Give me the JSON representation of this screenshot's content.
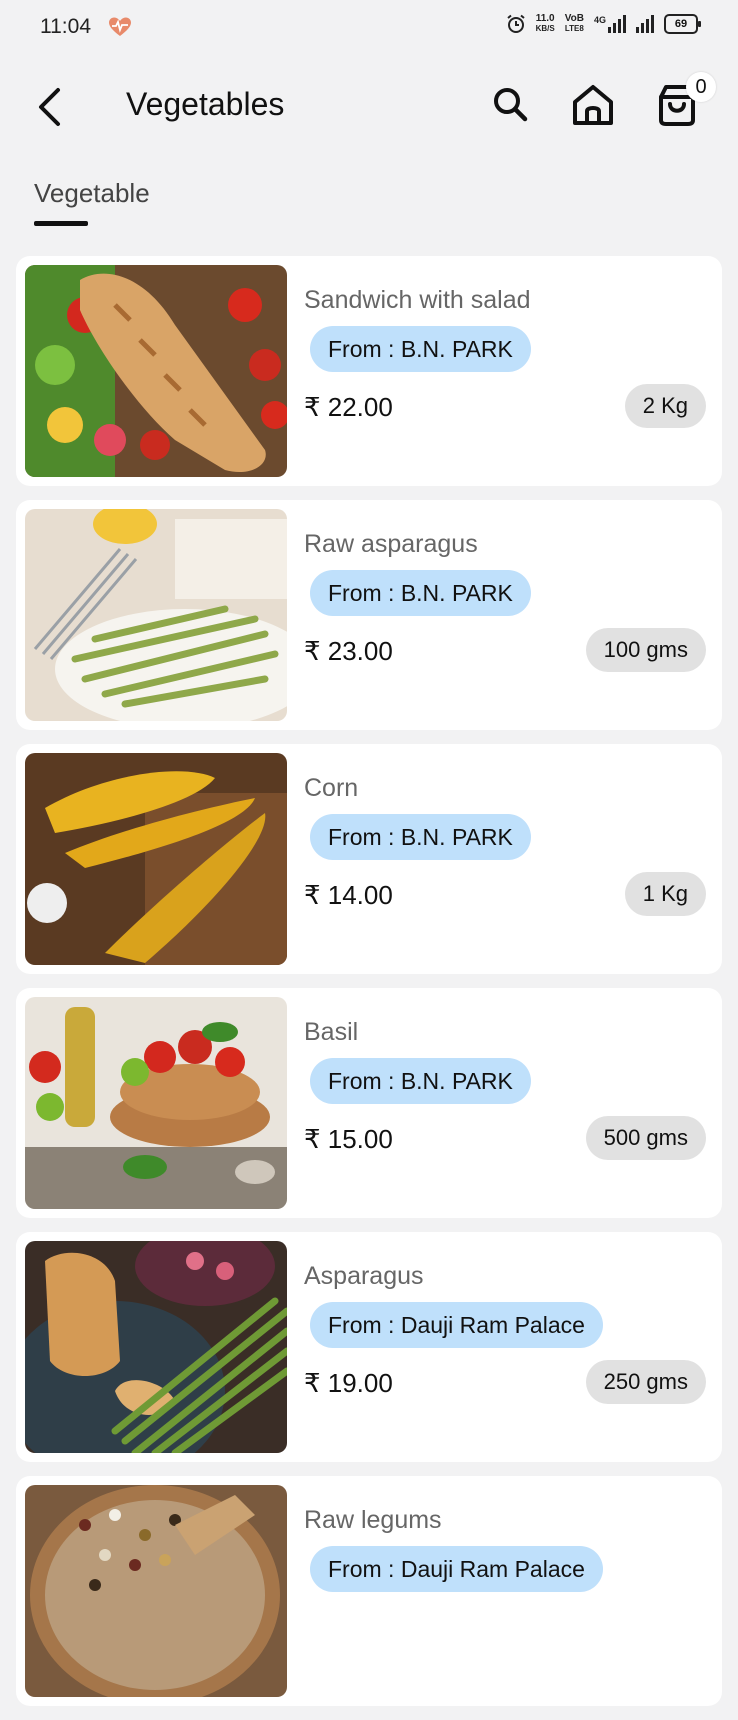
{
  "status_bar": {
    "time": "11:04",
    "network_speed_top": "11.0",
    "network_speed_bottom": "KB/S",
    "volte_top": "VoB",
    "volte_bottom": "LTE8",
    "network_type": "4G",
    "battery": "69",
    "icons": [
      "heart-health-icon",
      "alarm-icon",
      "signal-icon",
      "battery-icon"
    ]
  },
  "header": {
    "title": "Vegetables",
    "cart_count": "0",
    "icons": [
      "back-arrow-icon",
      "search-icon",
      "home-icon",
      "shopping-bag-icon"
    ]
  },
  "tabs": [
    {
      "label": "Vegetable",
      "active": true
    }
  ],
  "products": [
    {
      "name": "Sandwich with salad",
      "from": "From : B.N. PARK",
      "price": "₹ 22.00",
      "qty": "2 Kg"
    },
    {
      "name": "Raw asparagus",
      "from": "From : B.N. PARK",
      "price": "₹ 23.00",
      "qty": "100 gms"
    },
    {
      "name": "Corn",
      "from": "From : B.N. PARK",
      "price": "₹ 14.00",
      "qty": "1 Kg"
    },
    {
      "name": "Basil",
      "from": "From : B.N. PARK",
      "price": "₹ 15.00",
      "qty": "500 gms"
    },
    {
      "name": "Asparagus",
      "from": "From : Dauji Ram Palace",
      "price": "₹ 19.00",
      "qty": "250 gms"
    },
    {
      "name": "Raw legums",
      "from": "From : Dauji Ram Palace",
      "price": "",
      "qty": ""
    }
  ],
  "colors": {
    "background": "#f2f2f3",
    "card": "#ffffff",
    "from_chip": "#bfe0fb",
    "qty_chip": "#e1e1e1",
    "heart": "#e88a6a"
  }
}
